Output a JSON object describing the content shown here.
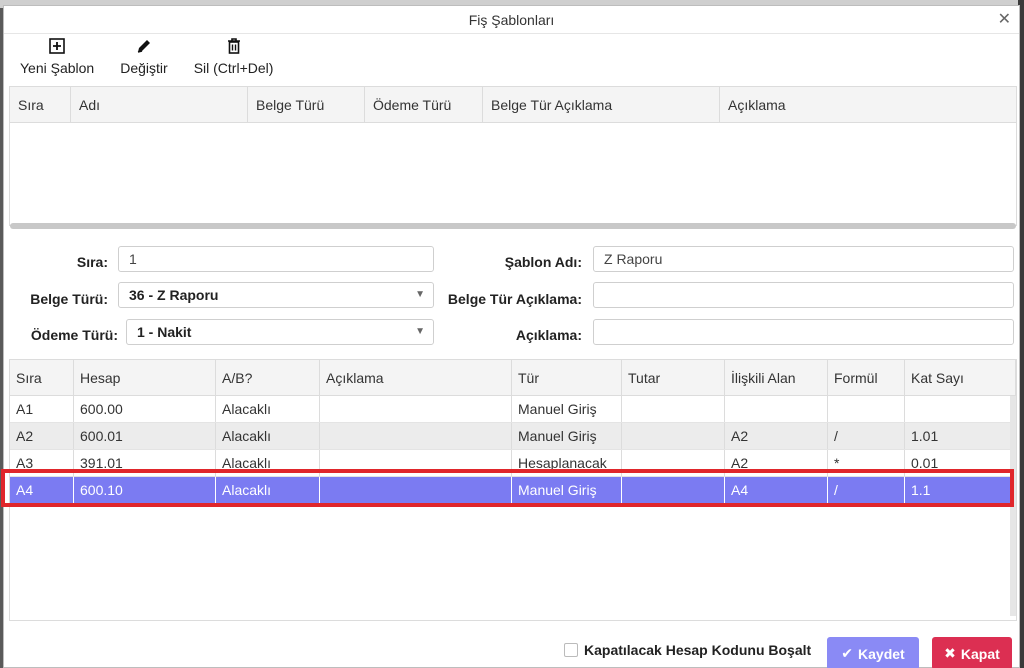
{
  "dialog": {
    "title": "Fiş Şablonları"
  },
  "toolbar": {
    "new_label": "Yeni Şablon",
    "edit_label": "Değiştir",
    "delete_label": "Sil (Ctrl+Del)"
  },
  "templates_grid": {
    "columns": [
      "Sıra",
      "Adı",
      "Belge Türü",
      "Ödeme Türü",
      "Belge Tür Açıklama",
      "Açıklama"
    ]
  },
  "form": {
    "sira_label": "Sıra:",
    "sira_value": "1",
    "belge_turu_label": "Belge Türü:",
    "belge_turu_value": "36 - Z Raporu",
    "odeme_turu_label": "Ödeme Türü:",
    "odeme_turu_value": "1 - Nakit",
    "sablon_adi_label": "Şablon Adı:",
    "sablon_adi_value": "Z Raporu",
    "belge_tur_aciklama_label": "Belge Tür Açıklama:",
    "belge_tur_aciklama_value": "",
    "aciklama_label": "Açıklama:",
    "aciklama_value": ""
  },
  "lines_grid": {
    "columns": [
      "Sıra",
      "Hesap",
      "A/B?",
      "Açıklama",
      "Tür",
      "Tutar",
      "İlişkili Alan",
      "Formül",
      "Kat Sayı"
    ],
    "rows": [
      [
        "A1",
        "600.00",
        "Alacaklı",
        "",
        "Manuel Giriş",
        "",
        "",
        "",
        ""
      ],
      [
        "A2",
        "600.01",
        "Alacaklı",
        "",
        "Manuel Giriş",
        "",
        "A2",
        "/",
        "1.01"
      ],
      [
        "A3",
        "391.01",
        "Alacaklı",
        "",
        "Hesaplanacak",
        "",
        "A2",
        "*",
        "0.01"
      ],
      [
        "A4",
        "600.10",
        "Alacaklı",
        "",
        "Manuel Giriş",
        "",
        "A4",
        "/",
        "1.1"
      ]
    ],
    "selected_row": 3
  },
  "footer": {
    "checkbox_label": "Kapatılacak Hesap Kodunu Boşalt",
    "checkbox_checked": false,
    "save_label": "Kaydet",
    "close_label": "Kapat"
  },
  "colors": {
    "selected_row": "#7b7bf2",
    "highlight_border": "#e0262b",
    "save_button": "#8a8af5",
    "close_button": "#dc2f52"
  }
}
